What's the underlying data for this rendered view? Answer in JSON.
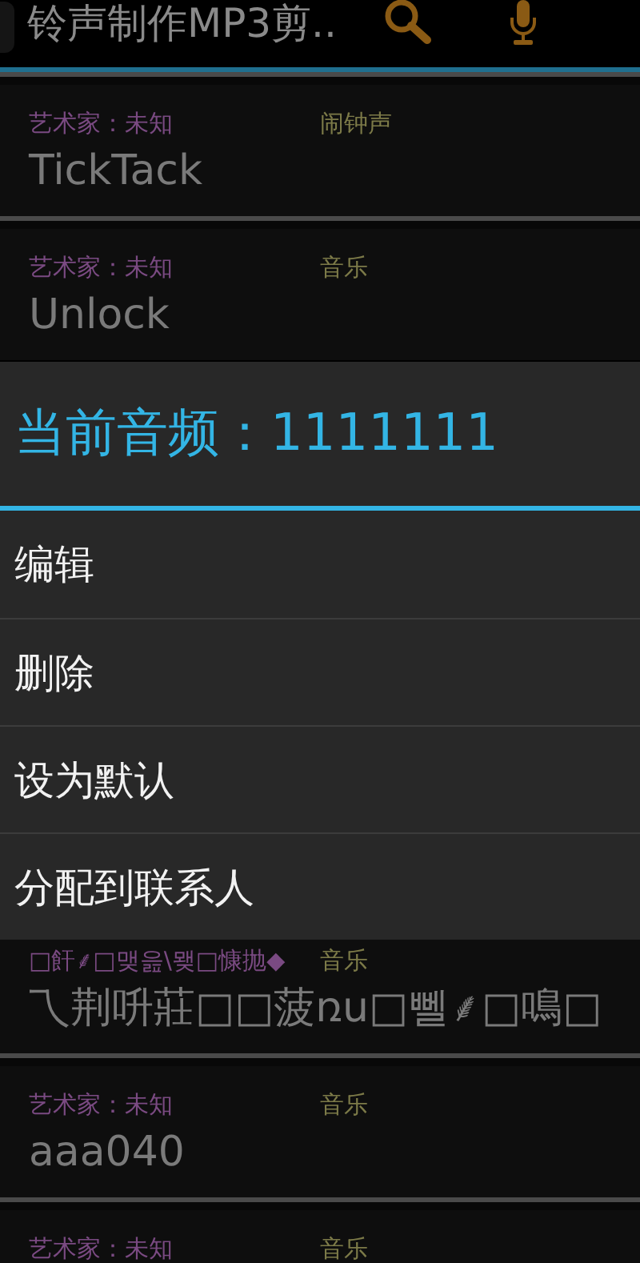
{
  "header": {
    "title": "铃声制作MP3剪.."
  },
  "songs_above": [
    {
      "artist": "艺术家：未知",
      "category": "闹钟声",
      "title": "TickTack"
    },
    {
      "artist": "艺术家：未知",
      "category": "音乐",
      "title": "Unlock"
    }
  ],
  "songs_below": [
    {
      "artist": "□飦⸙□맺읊\\뫶□慷抛◆",
      "category": "音乐",
      "title": "乁荆呏莊□□菠ռu□뻴⸙□鳴□"
    },
    {
      "artist": "艺术家：未知",
      "category": "音乐",
      "title": "aaa040"
    },
    {
      "artist": "艺术家：未知",
      "category": "音乐"
    }
  ],
  "dialog": {
    "title": "当前音频：1111111",
    "items": [
      "编辑",
      "删除",
      "设为默认",
      "分配到联系人"
    ]
  }
}
